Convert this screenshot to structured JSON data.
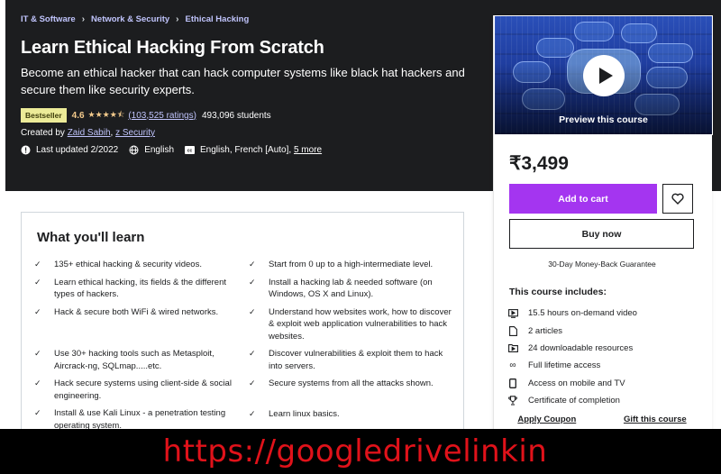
{
  "breadcrumb": [
    "IT & Software",
    "Network & Security",
    "Ethical Hacking"
  ],
  "breadcrumb_separator": "›",
  "course": {
    "title": "Learn Ethical Hacking From Scratch",
    "subtitle": "Become an ethical hacker that can hack computer systems like black hat hackers and secure them like security experts.",
    "badge": "Bestseller",
    "rating": "4.6",
    "stars_display": "★★★★⯪",
    "ratings_count": "(103,525 ratings)",
    "students": "493,096 students",
    "created_by_label": "Created by",
    "authors": [
      "Zaid Sabih",
      "z Security"
    ],
    "last_updated": "Last updated 2/2022",
    "language": "English",
    "captions": "English, French [Auto],",
    "captions_more": "5 more"
  },
  "learn": {
    "title": "What you'll learn",
    "left": [
      "135+ ethical hacking & security videos.",
      "Learn ethical hacking, its fields & the different types of hackers.",
      "Hack & secure both WiFi & wired networks.",
      "Use 30+ hacking tools such as Metasploit, Aircrack-ng, SQLmap.....etc.",
      "Hack secure systems using client-side & social engineering.",
      "Install & use Kali Linux - a penetration testing operating system."
    ],
    "right": [
      "Start from 0 up to a high-intermediate level.",
      "Install a hacking lab & needed software (on Windows, OS X and Linux).",
      "Understand how websites work, how to discover & exploit web application vulnerabilities to hack websites.",
      "Discover vulnerabilities & exploit them to hack into servers.",
      "Secure systems from all the attacks shown.",
      "Learn linux basics."
    ]
  },
  "sidebar": {
    "preview_label": "Preview this course",
    "price": "₹3,499",
    "add_to_cart": "Add to cart",
    "buy_now": "Buy now",
    "guarantee": "30-Day Money-Back Guarantee",
    "includes_title": "This course includes:",
    "includes": [
      {
        "icon": "video-icon",
        "text": "15.5 hours on-demand video"
      },
      {
        "icon": "article-icon",
        "text": "2 articles"
      },
      {
        "icon": "download-icon",
        "text": "24 downloadable resources"
      },
      {
        "icon": "infinity-icon",
        "text": "Full lifetime access"
      },
      {
        "icon": "mobile-icon",
        "text": "Access on mobile and TV"
      },
      {
        "icon": "trophy-icon",
        "text": "Certificate of completion"
      }
    ],
    "apply_coupon": "Apply Coupon",
    "gift_course": "Gift this course"
  },
  "overlay": {
    "text": "https://googledrivelinkin"
  },
  "colors": {
    "hero_bg": "#1c1d1f",
    "accent_purple": "#a435f0",
    "link_lavender": "#c0c4fc",
    "star_gold": "#f3ca8c",
    "badge_bg": "#eceb98",
    "overlay_text": "#e0121a"
  }
}
